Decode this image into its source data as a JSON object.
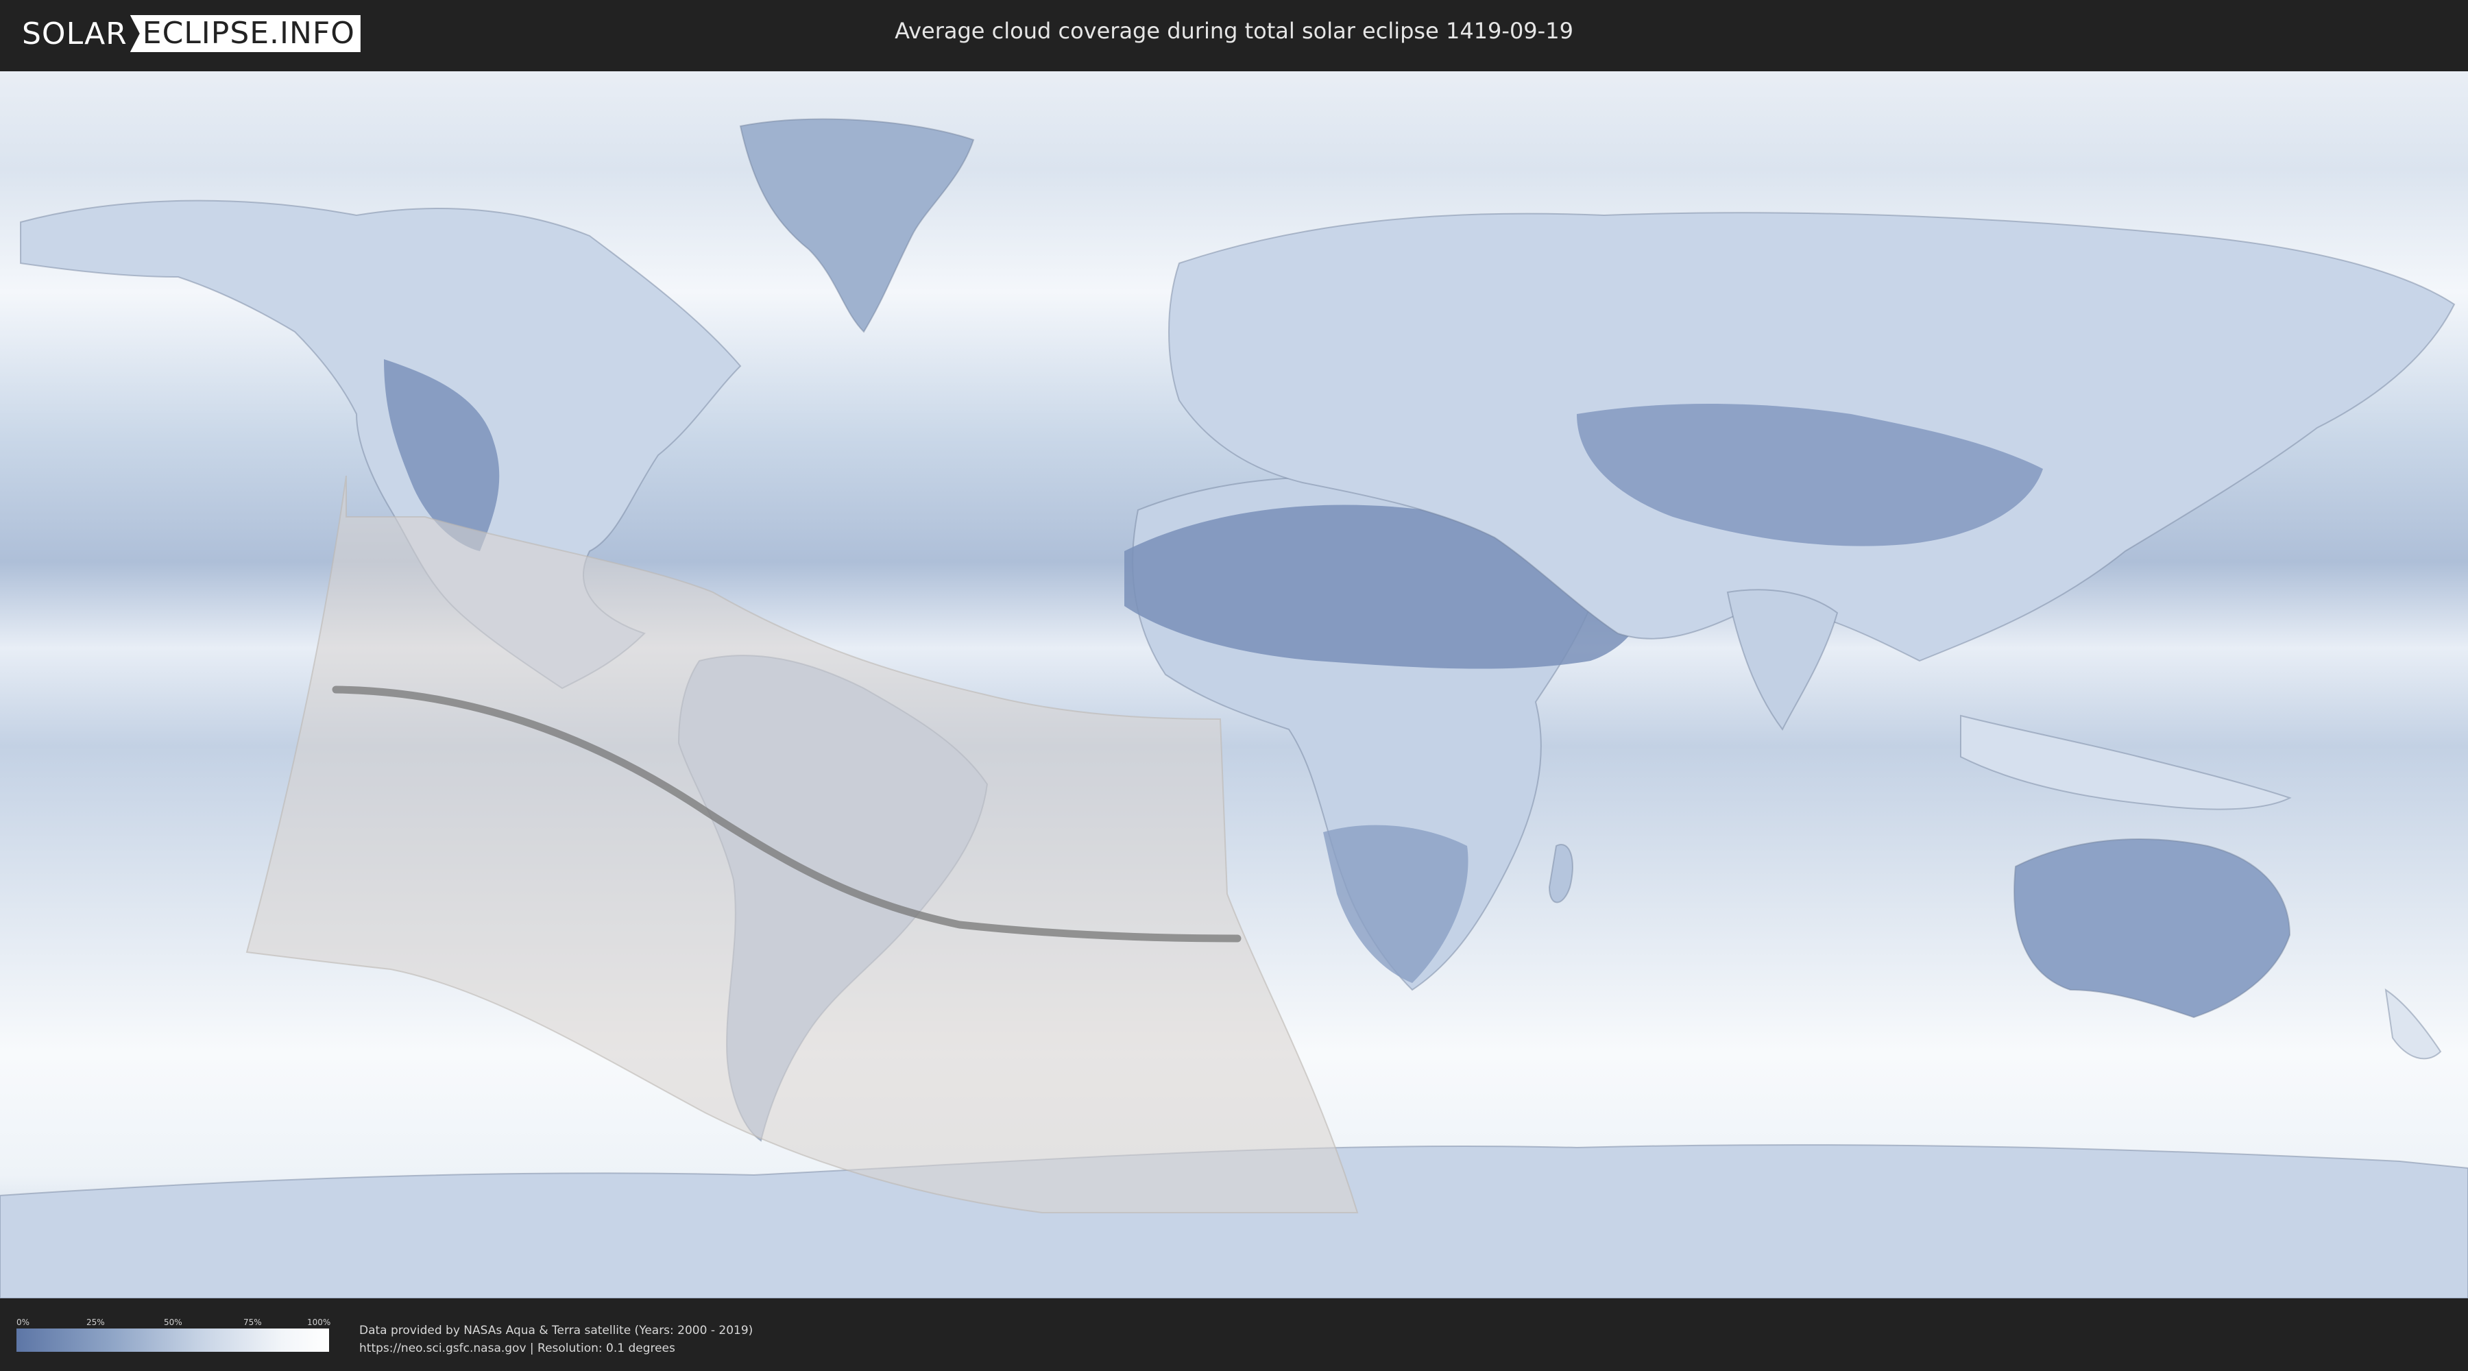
{
  "header": {
    "logo_left": "SOLAR",
    "logo_right": "ECLIPSE.INFO",
    "title": "Average cloud coverage during total solar eclipse 1419-09-19"
  },
  "map": {
    "layers": [
      "cloud-coverage-heatmap",
      "country-borders",
      "eclipse-penumbra-zone",
      "totality-path-line"
    ],
    "colors": {
      "clear": "#5d76a6",
      "cloudy": "#ffffff",
      "shadow_zone": "#d8d4cf",
      "totality_path": "#777777"
    }
  },
  "legend": {
    "ticks": [
      "0%",
      "25%",
      "50%",
      "75%",
      "100%"
    ]
  },
  "footer": {
    "credit_line1": "Data provided by NASAs Aqua & Terra satellite (Years: 2000 - 2019)",
    "credit_line2": "https://neo.sci.gsfc.nasa.gov | Resolution: 0.1 degrees"
  }
}
